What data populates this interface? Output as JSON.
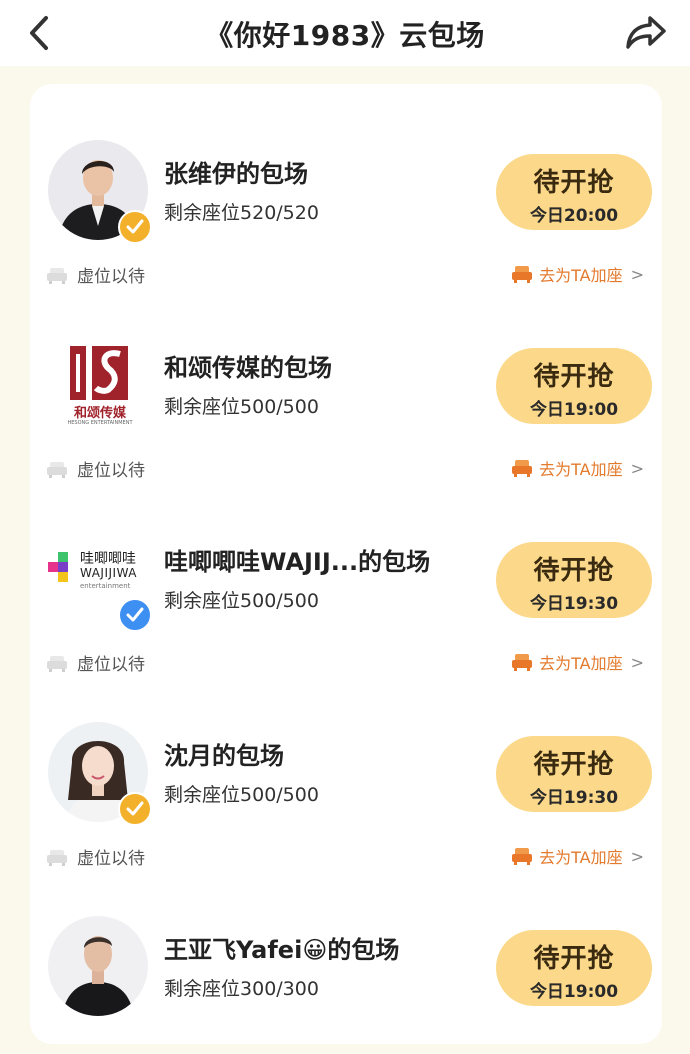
{
  "header": {
    "title": "《你好1983》云包场",
    "back_icon": "chevron-left-icon",
    "share_icon": "share-arrow-icon"
  },
  "colors": {
    "accent_button": "#fcd98a",
    "add_link": "#e37a2d",
    "badge_gold": "#f3b12b",
    "badge_blue": "#3e8ff2",
    "page_bg": "#fbf8ec"
  },
  "items": [
    {
      "name": "张维伊的包场",
      "seats_label": "剩余座位",
      "seats_value": "520/520",
      "button_main": "待开抢",
      "button_time": "今日20:00",
      "wait_text": "虚位以待",
      "add_text": "去为TA加座",
      "chevron": ">",
      "avatar": "person-avatar",
      "badge": "gold-verified-badge"
    },
    {
      "name": "和颂传媒的包场",
      "seats_label": "剩余座位",
      "seats_value": "500/500",
      "button_main": "待开抢",
      "button_time": "今日19:00",
      "wait_text": "虚位以待",
      "add_text": "去为TA加座",
      "chevron": ">",
      "avatar": "heson-logo",
      "logo_text": "和颂传媒",
      "logo_subtext": "HESONG ENTERTAINMENT"
    },
    {
      "name": "哇唧唧哇WAJIJ...的包场",
      "seats_label": "剩余座位",
      "seats_value": "500/500",
      "button_main": "待开抢",
      "button_time": "今日19:30",
      "wait_text": "虚位以待",
      "add_text": "去为TA加座",
      "chevron": ">",
      "avatar": "wajijiwa-logo",
      "logo_text": "哇唧唧哇",
      "logo_word": "WAJIJIWA",
      "logo_subtext": "entertainment",
      "badge": "blue-verified-badge"
    },
    {
      "name": "沈月的包场",
      "seats_label": "剩余座位",
      "seats_value": "500/500",
      "button_main": "待开抢",
      "button_time": "今日19:30",
      "wait_text": "虚位以待",
      "add_text": "去为TA加座",
      "chevron": ">",
      "avatar": "person-avatar",
      "badge": "gold-verified-badge"
    },
    {
      "name": "王亚飞Yafei😀的包场",
      "seats_label": "剩余座位",
      "seats_value": "300/300",
      "button_main": "待开抢",
      "button_time": "今日19:00",
      "avatar": "person-avatar"
    }
  ]
}
